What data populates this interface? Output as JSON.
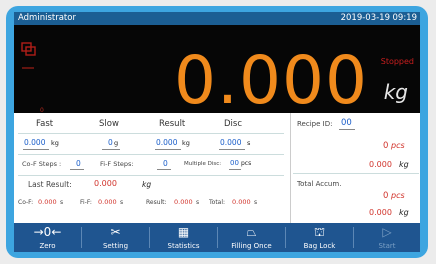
{
  "header": {
    "title": "Administrator",
    "date": "2019-03-19",
    "time": "09:19"
  },
  "display": {
    "weight": "0.000",
    "unit": "kg",
    "status": "Stopped",
    "indicator": "0"
  },
  "tabs": [
    "Fast",
    "Slow",
    "Result",
    "Disc"
  ],
  "targets": {
    "fast_value": "0.000",
    "fast_unit": "kg",
    "slow_value": "0",
    "slow_unit": "g",
    "result_value": "0.000",
    "result_unit": "kg",
    "disc_value": "0.000",
    "disc_unit": "s"
  },
  "steps": {
    "co_f_label": "Co-F Steps :",
    "co_f_value": "0",
    "fi_f_label": "Fi-F Steps:",
    "fi_f_value": "0",
    "multiple_label": "Multiple Disc:",
    "multiple_value": "00",
    "multiple_unit": "pcs"
  },
  "last_result": {
    "label": "Last Result:",
    "value": "0.000",
    "unit": "kg"
  },
  "times": [
    {
      "label": "Co-F:",
      "value": "0.000",
      "unit": "s"
    },
    {
      "label": "Fi-F:",
      "value": "0.000",
      "unit": "s"
    },
    {
      "label": "Result:",
      "value": "0.000",
      "unit": "s"
    },
    {
      "label": "Total:",
      "value": "0.000",
      "unit": "s"
    }
  ],
  "recipe": {
    "label": "Recipe ID:",
    "id": "00",
    "pcs_value": "0",
    "pcs_unit": "pcs",
    "kg_value": "0.000",
    "kg_unit": "kg"
  },
  "total": {
    "label": "Total Accum.",
    "pcs_value": "0",
    "pcs_unit": "pcs",
    "kg_value": "0.000",
    "kg_unit": "kg"
  },
  "buttons": {
    "zero": "Zero",
    "setting": "Setting",
    "statistics": "Statistics",
    "filling_once": "Filling Once",
    "bag_lock": "Bag Lock",
    "start": "Start"
  },
  "colors": {
    "accent": "#1f5590",
    "digits": "#f08a1c",
    "alert": "#c81e1e",
    "frame": "#3da5e0"
  }
}
